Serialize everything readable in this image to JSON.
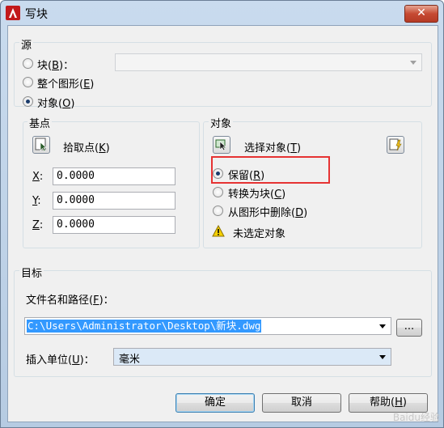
{
  "window": {
    "title": "写块",
    "close_label": "✕"
  },
  "source": {
    "group_label": "源",
    "options": [
      {
        "label": "块(",
        "mnemonic": "B",
        "suffix": ")：",
        "checked": false
      },
      {
        "label": "整个图形(",
        "mnemonic": "E",
        "suffix": ")",
        "checked": false
      },
      {
        "label": "对象(",
        "mnemonic": "O",
        "suffix": ")",
        "checked": true
      }
    ],
    "block_combo_value": ""
  },
  "base_point": {
    "group_label": "基点",
    "pick_label": "拾取点(",
    "pick_mnemonic": "K",
    "pick_suffix": ")",
    "x_label": "X",
    "x_value": "0.0000",
    "y_label": "Y",
    "y_value": "0.0000",
    "z_label": "Z",
    "z_value": "0.0000"
  },
  "objects": {
    "group_label": "对象",
    "select_label": "选择对象(",
    "select_mnemonic": "T",
    "select_suffix": ")",
    "options": [
      {
        "label": "保留(",
        "mnemonic": "R",
        "suffix": ")",
        "checked": true
      },
      {
        "label": "转换为块(",
        "mnemonic": "C",
        "suffix": ")",
        "checked": false
      },
      {
        "label": "从图形中删除(",
        "mnemonic": "D",
        "suffix": ")",
        "checked": false
      }
    ],
    "warning_text": "未选定对象"
  },
  "destination": {
    "group_label": "目标",
    "path_label": "文件名和路径(",
    "path_mnemonic": "F",
    "path_suffix": ")：",
    "path_value": "C:\\Users\\Administrator\\Desktop\\新块.dwg",
    "browse_label": "...",
    "units_label": "插入单位(",
    "units_mnemonic": "U",
    "units_suffix": ")：",
    "units_value": "毫米"
  },
  "buttons": {
    "ok": "确定",
    "cancel": "取消",
    "help": "帮助(",
    "help_mnemonic": "H",
    "help_suffix": ")"
  },
  "watermark": "Baidu经验"
}
